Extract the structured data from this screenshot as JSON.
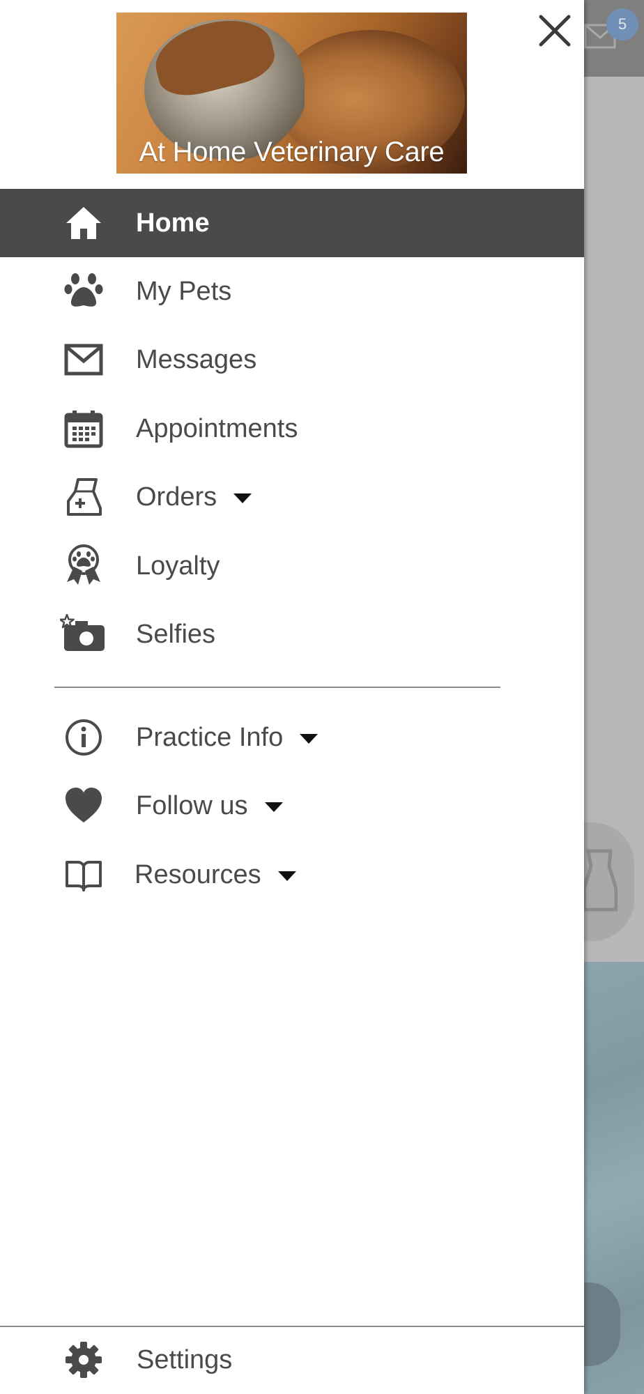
{
  "background": {
    "message_badge_count": "5"
  },
  "drawer": {
    "banner": {
      "title": "At Home Veterinary Care"
    },
    "primary_items": [
      {
        "label": "Home",
        "icon": "home-icon",
        "active": true
      },
      {
        "label": "My Pets",
        "icon": "paw-icon",
        "active": false
      },
      {
        "label": "Messages",
        "icon": "envelope-icon",
        "active": false
      },
      {
        "label": "Appointments",
        "icon": "calendar-icon",
        "active": false
      },
      {
        "label": "Orders",
        "icon": "medicine-bag-icon",
        "active": false,
        "has_dropdown": true
      },
      {
        "label": "Loyalty",
        "icon": "paw-award-icon",
        "active": false
      },
      {
        "label": "Selfies",
        "icon": "camera-star-icon",
        "active": false
      }
    ],
    "secondary_items": [
      {
        "label": "Practice Info",
        "icon": "info-icon",
        "has_dropdown": true
      },
      {
        "label": "Follow us",
        "icon": "heart-icon",
        "has_dropdown": true
      },
      {
        "label": "Resources",
        "icon": "book-icon",
        "has_dropdown": true
      }
    ],
    "footer_item": {
      "label": "Settings",
      "icon": "gear-icon"
    }
  },
  "colors": {
    "active_item_bg": "#4a4a4a",
    "text": "#4a4a4a",
    "badge": "#6f8fb5"
  }
}
